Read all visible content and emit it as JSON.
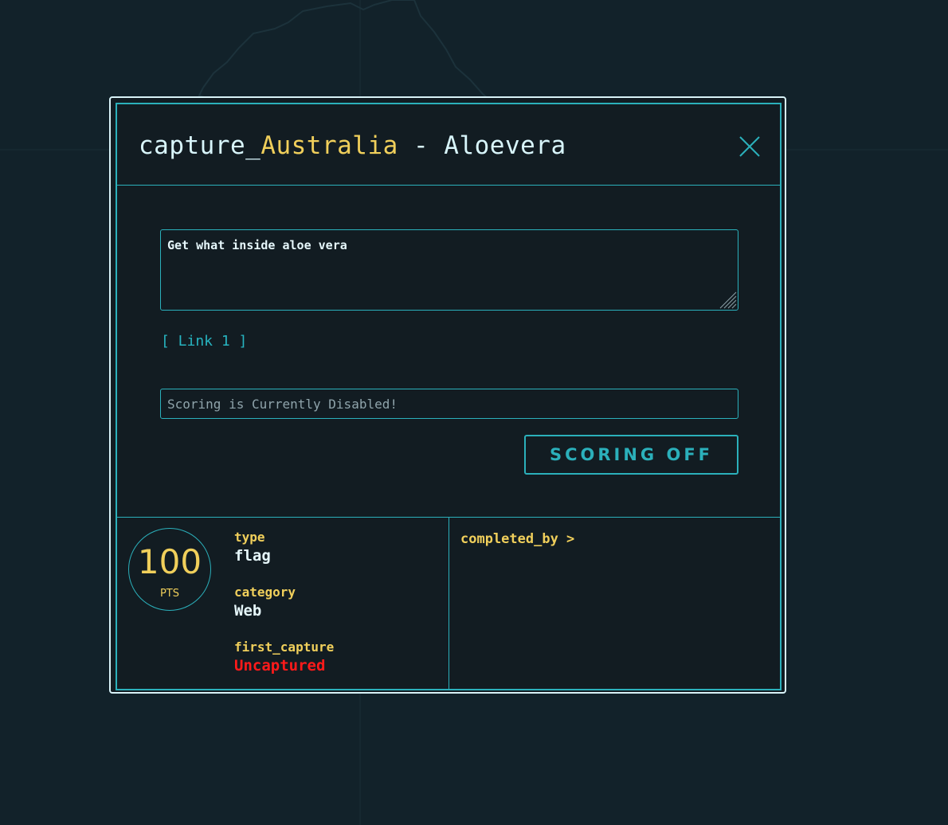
{
  "modal": {
    "title_prefix": "capture_",
    "title_country": "Australia",
    "title_separator": " - ",
    "title_name": "Aloevera",
    "close_icon": "close-icon"
  },
  "challenge": {
    "description": "Get what inside aloe vera",
    "link_label": "[ Link 1 ]",
    "flag_placeholder": "Scoring is Currently Disabled!",
    "submit_label": "SCORING OFF"
  },
  "stats": {
    "points": "100",
    "points_unit": "PTS",
    "type_label": "type",
    "type_value": "flag",
    "category_label": "category",
    "category_value": "Web",
    "first_capture_label": "first_capture",
    "first_capture_value": "Uncaptured",
    "completed_by_label": "completed_by >"
  },
  "colors": {
    "background": "#12222a",
    "modal_bg": "#121c22",
    "accent_cyan": "#2bb0bb",
    "accent_yellow": "#f0cf5b",
    "text_light": "#e6f7fb",
    "status_red": "#ff1a1a"
  }
}
